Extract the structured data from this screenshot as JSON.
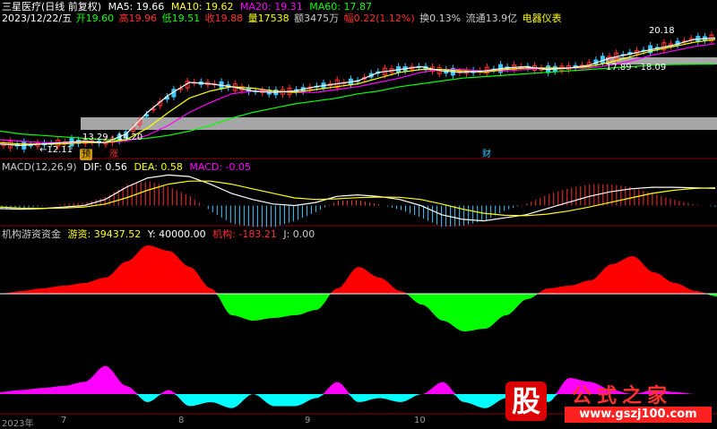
{
  "header": {
    "line1": {
      "title": "三星医疗(日线 前复权)",
      "ma5": "MA5: 19.66",
      "ma10": "MA10: 19.62",
      "ma20": "MA20: 19.31",
      "ma60": "MA60: 17.87"
    },
    "line2": {
      "date": "2023/12/22/五",
      "open": "开19.60",
      "high": "高19.96",
      "low": "低19.51",
      "close": "收19.88",
      "volume": "量17538",
      "amount": "额3475万",
      "change": "幅0.22(1.12%)",
      "turnover": "换0.13%",
      "float_cap": "流通13.9亿",
      "sector": "电器仪表"
    },
    "price_labels": {
      "high_label": "20.18",
      "zone_top": "17.89 - 18.09",
      "zone_bottom": "13.29 - 14.20",
      "low_label": "←12.11"
    },
    "markers": {
      "m1": "预",
      "m2": "涨",
      "m3": "财"
    }
  },
  "macd": {
    "title": "MACD(12,26,9)",
    "dif": "DIF: 0.56",
    "dea": "DEA: 0.58",
    "macd": "MACD: -0.05"
  },
  "indicator": {
    "title": "机构游资资金",
    "youzi": "游资: 39437.52",
    "y": "Y: 40000.00",
    "jigou": "机构: -183.21",
    "j": "J: 0.00"
  },
  "xaxis": {
    "labels": [
      "2023年",
      "7",
      "8",
      "9",
      "10"
    ]
  },
  "watermark": {
    "logo_char": "股",
    "name": "公式之家",
    "url": "www.gszj100.com"
  },
  "colors": {
    "up": "#ff3030",
    "down": "#3cc8ff",
    "ma5": "#ffffff",
    "ma10": "#ffff00",
    "ma20": "#ff00ff",
    "ma60": "#00ff00",
    "zone": "#a6a6a6",
    "red_fill": "#ff0000",
    "green_fill": "#00ff00",
    "magenta_fill": "#ff00ff",
    "cyan_fill": "#00ffff"
  },
  "chart_data": {
    "type": "line",
    "price": {
      "ma5": [
        12.3,
        12.2,
        12.3,
        12.4,
        12.5,
        12.4,
        13.0,
        14.5,
        15.7,
        16.6,
        16.5,
        16.3,
        16.0,
        15.9,
        16.0,
        16.3,
        16.5,
        16.7,
        17.3,
        17.5,
        17.7,
        17.4,
        17.3,
        17.4,
        17.6,
        17.7,
        17.5,
        17.6,
        17.8,
        18.3,
        18.6,
        18.9,
        19.2,
        19.6,
        19.7
      ],
      "ma10": [
        12.4,
        12.3,
        12.3,
        12.3,
        12.4,
        12.4,
        12.6,
        13.4,
        14.5,
        15.5,
        16.0,
        16.3,
        16.2,
        16.0,
        15.9,
        16.1,
        16.3,
        16.5,
        16.9,
        17.3,
        17.5,
        17.5,
        17.4,
        17.3,
        17.5,
        17.6,
        17.6,
        17.6,
        17.7,
        18.0,
        18.4,
        18.8,
        19.1,
        19.4,
        19.6
      ],
      "ma20": [
        12.6,
        12.5,
        12.4,
        12.4,
        12.4,
        12.4,
        12.5,
        12.9,
        13.6,
        14.5,
        15.2,
        15.8,
        16.0,
        16.0,
        15.9,
        15.9,
        16.1,
        16.3,
        16.6,
        16.9,
        17.3,
        17.5,
        17.5,
        17.4,
        17.4,
        17.5,
        17.6,
        17.6,
        17.6,
        17.8,
        18.1,
        18.5,
        18.8,
        19.1,
        19.3
      ],
      "ma60": [
        13.2,
        13.0,
        12.9,
        12.8,
        12.7,
        12.6,
        12.6,
        12.7,
        12.9,
        13.2,
        13.6,
        14.1,
        14.5,
        14.8,
        15.1,
        15.3,
        15.5,
        15.8,
        16.0,
        16.3,
        16.5,
        16.7,
        16.9,
        17.0,
        17.1,
        17.2,
        17.3,
        17.4,
        17.5,
        17.6,
        17.7,
        17.8,
        17.85,
        17.86,
        17.87
      ],
      "ylim": [
        11.6,
        20.6
      ]
    },
    "macd": {
      "dif": [
        -0.1,
        -0.12,
        -0.1,
        -0.05,
        0.0,
        0.2,
        0.6,
        0.9,
        1.0,
        0.95,
        0.7,
        0.4,
        0.2,
        0.05,
        0.0,
        0.1,
        0.3,
        0.35,
        0.3,
        0.2,
        0.0,
        -0.3,
        -0.45,
        -0.5,
        -0.4,
        -0.3,
        -0.1,
        0.1,
        0.3,
        0.45,
        0.55,
        0.6,
        0.6,
        0.58,
        0.56
      ],
      "dea": [
        -0.05,
        -0.08,
        -0.09,
        -0.08,
        -0.05,
        0.05,
        0.25,
        0.5,
        0.7,
        0.8,
        0.8,
        0.7,
        0.55,
        0.4,
        0.25,
        0.2,
        0.22,
        0.26,
        0.28,
        0.27,
        0.2,
        0.05,
        -0.12,
        -0.25,
        -0.32,
        -0.33,
        -0.28,
        -0.18,
        -0.05,
        0.1,
        0.25,
        0.4,
        0.5,
        0.56,
        0.58
      ],
      "ylim": [
        -0.6,
        1.1
      ]
    },
    "funds": {
      "main": [
        0.0,
        0.05,
        0.1,
        0.15,
        0.2,
        0.3,
        0.6,
        0.9,
        0.8,
        0.5,
        0.1,
        -0.4,
        -0.5,
        -0.45,
        -0.4,
        -0.3,
        0.1,
        0.5,
        0.3,
        0.05,
        -0.2,
        -0.5,
        -0.7,
        -0.65,
        -0.4,
        -0.1,
        0.1,
        0.15,
        0.25,
        0.55,
        0.7,
        0.4,
        0.2,
        0.05,
        -0.05
      ],
      "lower": [
        0.05,
        0.1,
        0.15,
        0.2,
        0.3,
        0.7,
        0.2,
        -0.2,
        0.1,
        -0.3,
        -0.2,
        -0.35,
        0.0,
        -0.3,
        -0.3,
        -0.1,
        0.3,
        -0.2,
        -0.1,
        -0.2,
        0.0,
        0.3,
        -0.2,
        -0.35,
        -0.1,
        0.1,
        -0.2,
        0.4,
        0.3,
        0.1,
        0.0,
        0.1,
        0.05,
        0.0,
        0.0
      ]
    }
  }
}
